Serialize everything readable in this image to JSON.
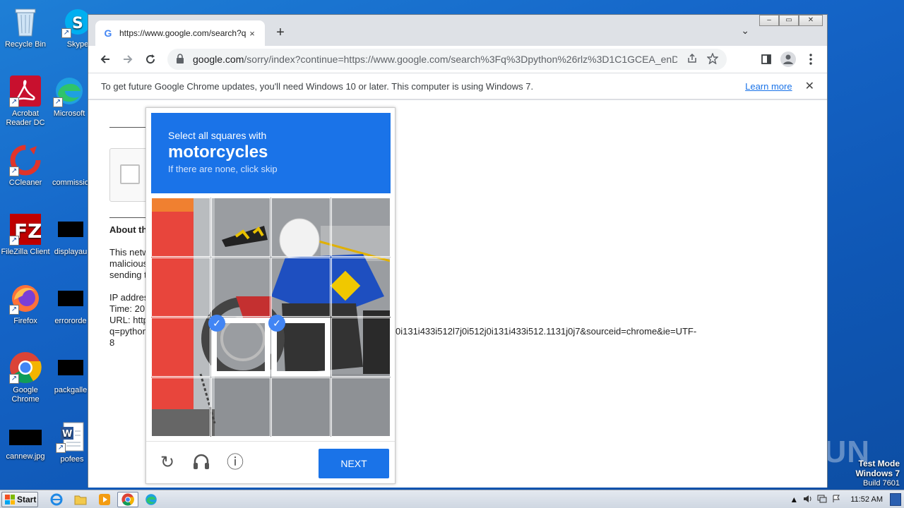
{
  "desktop": {
    "icons": [
      {
        "label": "Recycle Bin",
        "icon": "recycle-bin-icon"
      },
      {
        "label": "Skype",
        "icon": "skype-icon"
      },
      {
        "label": "Acrobat Reader DC",
        "icon": "acrobat-icon"
      },
      {
        "label": "Microsoft",
        "icon": "edge-icon"
      },
      {
        "label": "CCleaner",
        "icon": "ccleaner-icon"
      },
      {
        "label": "commissio",
        "icon": "file-icon"
      },
      {
        "label": "FileZilla Client",
        "icon": "filezilla-icon"
      },
      {
        "label": "displayau",
        "icon": "file-icon"
      },
      {
        "label": "Firefox",
        "icon": "firefox-icon"
      },
      {
        "label": "errororde",
        "icon": "file-icon"
      },
      {
        "label": "Google Chrome",
        "icon": "chrome-icon"
      },
      {
        "label": "packgalle",
        "icon": "file-icon"
      },
      {
        "label": "cannew.jpg",
        "icon": "image-icon"
      },
      {
        "label": "pofees",
        "icon": "word-icon"
      }
    ],
    "watermark": "ANY RUN",
    "test_mode": {
      "line1": "Test Mode",
      "line2": "Windows 7",
      "line3": "Build 7601"
    }
  },
  "browser": {
    "tab_title": "https://www.google.com/search?q=",
    "tab_close": "×",
    "new_tab": "+",
    "tab_menu": "⌄",
    "window_buttons": [
      "–",
      "▭",
      "✕"
    ],
    "url_host": "google.com",
    "url_rest": "/sorry/index?continue=https://www.google.com/search%3Fq%3Dpython%26rlz%3D1C1GCEA_enDE1...",
    "infobar": {
      "message": "To get future Google Chrome updates, you'll need Windows 10 or later. This computer is using Windows 7.",
      "link": "Learn more",
      "close": "✕"
    },
    "page": {
      "about": "About th",
      "para1": [
        "This netw",
        "malicious",
        "sending t"
      ],
      "ip": "IP addres",
      "time": "Time: 20",
      "url_label": "URL: http",
      "query": "q=python",
      "query_tail": "0i131i433i512l7j0i512j0i131i433i512.1131j0j7&sourceid=chrome&ie=UTF-",
      "query_end": "8"
    }
  },
  "captcha": {
    "line1": "Select all squares with",
    "target": "motorcycles",
    "line3": "If there are none, click skip",
    "selected_tiles": [
      9,
      10
    ],
    "next_label": "NEXT",
    "reload_icon": "↻",
    "audio_icon": "🎧",
    "info_icon": "ⓘ",
    "check": "✓"
  },
  "taskbar": {
    "start_label": "Start",
    "clock": "11:52 AM",
    "tray_up": "▲"
  }
}
